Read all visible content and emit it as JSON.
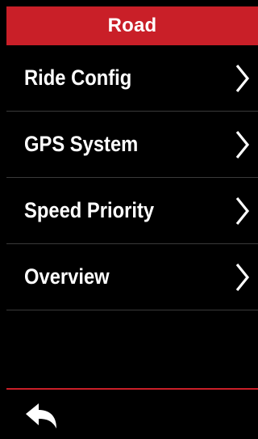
{
  "header": {
    "title": "Road",
    "accent_color": "#c91f28"
  },
  "menu": {
    "items": [
      {
        "label": "Ride Config",
        "icon": "chevron-right-icon"
      },
      {
        "label": "GPS System",
        "icon": "chevron-right-icon"
      },
      {
        "label": "Speed Priority",
        "icon": "chevron-right-icon"
      },
      {
        "label": "Overview",
        "icon": "chevron-right-icon"
      }
    ]
  },
  "footer": {
    "back_icon": "back-arrow-icon"
  }
}
